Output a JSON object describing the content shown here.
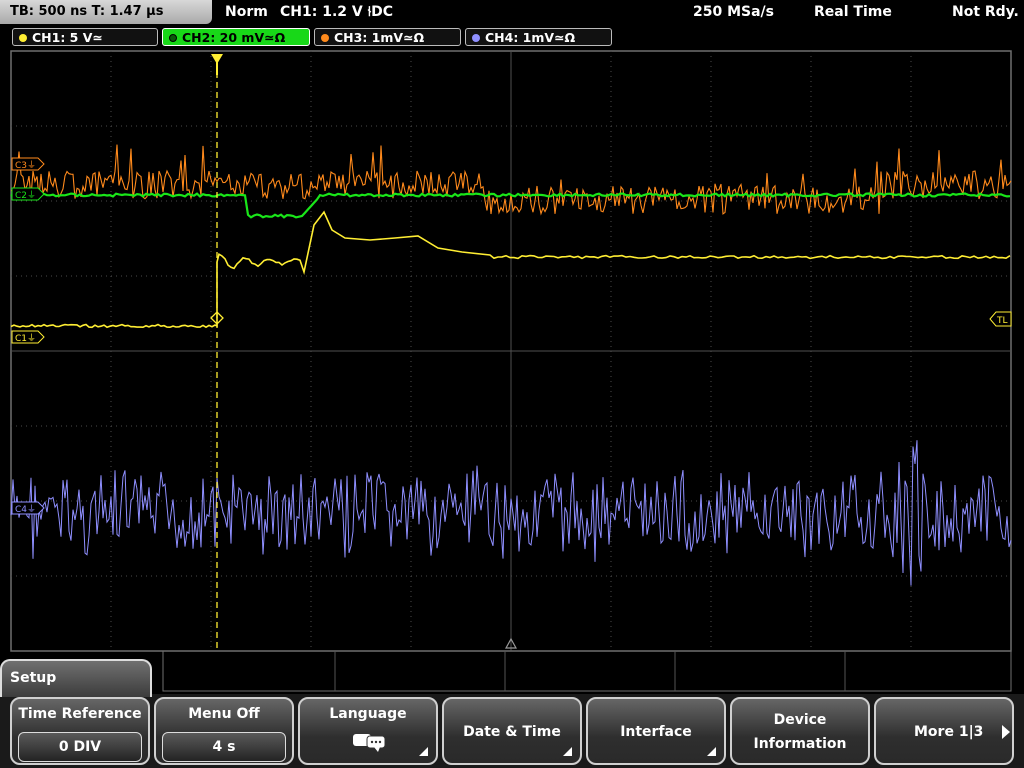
{
  "status": {
    "timebase": "TB: 500 ns   T: 1.47 µs",
    "mode": "Norm",
    "trigger": "CH1: 1.2 V ⫮DC",
    "sample_rate": "250 MSa/s",
    "acquisition": "Real Time",
    "ready": "Not Rdy."
  },
  "channels": [
    {
      "label": "CH1: 5 V≃",
      "color": "#ffee33"
    },
    {
      "label": "CH2: 20 mV≃Ω",
      "color": "#19e619",
      "active": true
    },
    {
      "label": "CH3: 1mV≃Ω",
      "color": "#ff8a1c"
    },
    {
      "label": "CH4: 1mV≃Ω",
      "color": "#8f8fff"
    }
  ],
  "markers": {
    "c3": "C3⏚",
    "c1": "C1⏚",
    "c2": "C2⏚",
    "c4": "C4⏚",
    "tl": "TL"
  },
  "menu": {
    "title": "Setup",
    "buttons": [
      {
        "label": "Time Reference",
        "value": "0 DIV"
      },
      {
        "label": "Menu Off",
        "value": "4 s"
      },
      {
        "label": "Language",
        "icon": "speech-bubbles-icon"
      },
      {
        "label": "Date & Time"
      },
      {
        "label": "Interface"
      },
      {
        "label": "Device",
        "label2": "Information"
      },
      {
        "label": "More 1|3",
        "icon": "play-arrow-icon"
      }
    ]
  }
}
